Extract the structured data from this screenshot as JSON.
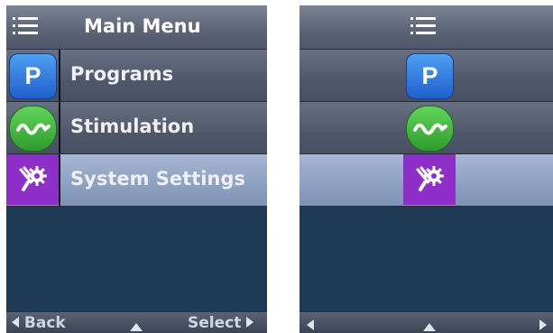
{
  "left_screen": {
    "header": {
      "title": "Main Menu",
      "icon": "list-menu-icon"
    },
    "menu_items": [
      {
        "label": "Programs",
        "icon": "programs-p-icon",
        "icon_letter": "P",
        "selected": false
      },
      {
        "label": "Stimulation",
        "icon": "stimulation-wave-icon",
        "selected": false
      },
      {
        "label": "System Settings",
        "icon": "system-settings-gear-icon",
        "selected": true
      }
    ],
    "footer": {
      "back_label": "Back",
      "select_label": "Select"
    }
  },
  "right_screen": {
    "header": {
      "icon": "list-menu-icon"
    },
    "menu_items": [
      {
        "icon": "programs-p-icon",
        "icon_letter": "P",
        "selected": false
      },
      {
        "icon": "stimulation-wave-icon",
        "selected": false
      },
      {
        "icon": "system-settings-gear-icon",
        "selected": true
      }
    ]
  },
  "colors": {
    "background": "#1e3a55",
    "selected_row": "#8ea2c2",
    "programs_icon": "#2f78dc",
    "stimulation_icon": "#3fb03b",
    "system_icon": "#8e2fc9"
  }
}
